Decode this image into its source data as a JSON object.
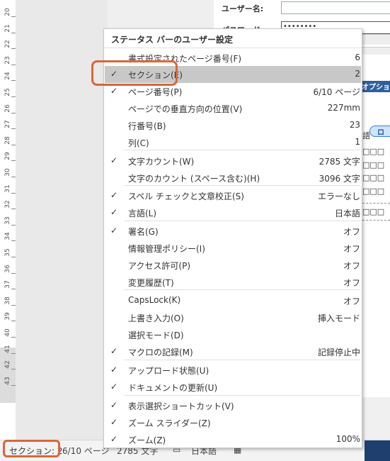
{
  "ruler": {
    "numbers": [
      "20",
      "21",
      "22",
      "23",
      "24",
      "25",
      "26",
      "27",
      "28",
      "29",
      "30",
      "31",
      "32",
      "33",
      "34",
      "35",
      "36",
      "37",
      "38",
      "39",
      "40",
      "41",
      "42",
      "43"
    ]
  },
  "form": {
    "user_label": "ユーザー名:",
    "password_label": "パスワード:",
    "password_value": "••••••••",
    "options_button": "オプション",
    "login_button": "ロ",
    "box_rows": [
      "□□□",
      "□□□",
      "□□□",
      "□□□",
      "□□□"
    ],
    "box_row_prefix": "語"
  },
  "menu": {
    "title": "ステータス バーのユーザー設定",
    "items": [
      {
        "checked": false,
        "label": "書式設定されたページ番号(F)",
        "value": "6"
      },
      {
        "checked": true,
        "label": "セクション(E)",
        "value": "2"
      },
      {
        "checked": true,
        "label": "ページ番号(P)",
        "value": "6/10 ページ"
      },
      {
        "checked": false,
        "label": "ページでの垂直方向の位置(V)",
        "value": "227mm"
      },
      {
        "checked": false,
        "label": "行番号(B)",
        "value": "23"
      },
      {
        "checked": false,
        "label": "列(C)",
        "value": "1"
      },
      {
        "checked": true,
        "label": "文字カウント(W)",
        "value": "2785 文字"
      },
      {
        "checked": false,
        "label": "文字のカウント (スペース含む)(H)",
        "value": "3096 文字"
      },
      {
        "checked": true,
        "label": "スペル チェックと文章校正(S)",
        "value": "エラーなし"
      },
      {
        "checked": true,
        "label": "言語(L)",
        "value": "日本語"
      },
      {
        "checked": true,
        "label": "署名(G)",
        "value": "オフ"
      },
      {
        "checked": false,
        "label": "情報管理ポリシー(I)",
        "value": "オフ"
      },
      {
        "checked": false,
        "label": "アクセス許可(P)",
        "value": "オフ"
      },
      {
        "checked": false,
        "label": "変更履歴(T)",
        "value": "オフ"
      },
      {
        "checked": false,
        "label": "CapsLock(K)",
        "value": "オフ"
      },
      {
        "checked": false,
        "label": "上書き入力(O)",
        "value": "挿入モード"
      },
      {
        "checked": false,
        "label": "選択モード(D)",
        "value": ""
      },
      {
        "checked": true,
        "label": "マクロの記録(M)",
        "value": "記録停止中"
      },
      {
        "checked": true,
        "label": "アップロード状態(U)",
        "value": ""
      },
      {
        "checked": true,
        "label": "ドキュメントの更新(U)",
        "value": ""
      },
      {
        "checked": true,
        "label": "表示選択ショートカット(V)",
        "value": ""
      },
      {
        "checked": true,
        "label": "ズーム スライダー(Z)",
        "value": ""
      },
      {
        "checked": true,
        "label": "ズーム(Z)",
        "value": "100%"
      }
    ],
    "selected_index": 1,
    "check_glyph": "✓"
  },
  "statusbar": {
    "section": "セクション: 2",
    "page": "6/10 ページ",
    "chars": "2785 文字",
    "language": "日本語"
  },
  "colors": {
    "highlight": "#d9673a",
    "selected_row": "#c8c8c8"
  }
}
